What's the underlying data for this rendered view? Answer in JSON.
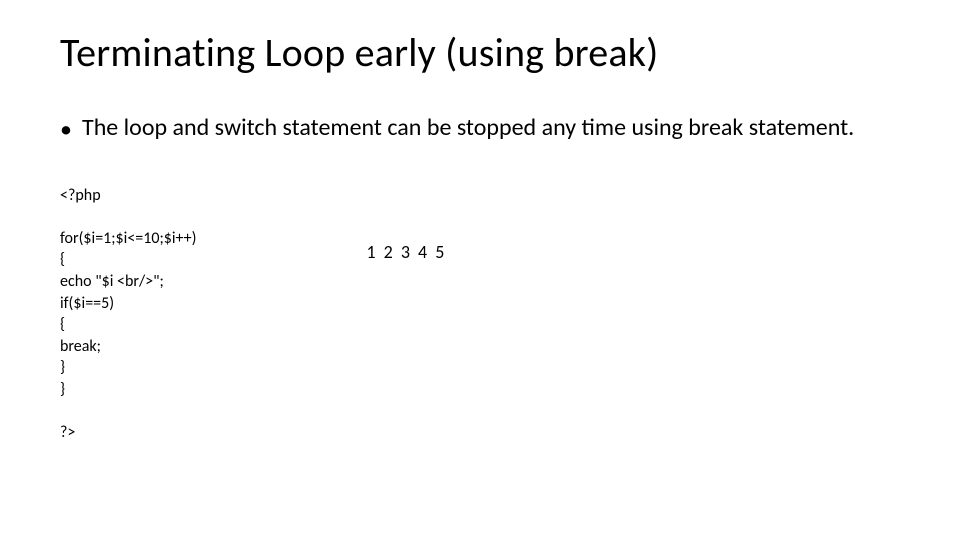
{
  "title": "Terminating Loop early (using break)",
  "bullet": "The loop and switch statement can be stopped any time using break statement.",
  "code": {
    "l1": "<?php",
    "l2": "",
    "l3": "for($i=1;$i<=10;$i++)",
    "l4": "{",
    "l5": "echo \"$i <br/>\";",
    "l6": "if($i==5)",
    "l7": "{",
    "l8": "break;",
    "l9": "}",
    "l10": "}",
    "l11": "",
    "l12": "?>"
  },
  "output": "1 2 3 4 5"
}
